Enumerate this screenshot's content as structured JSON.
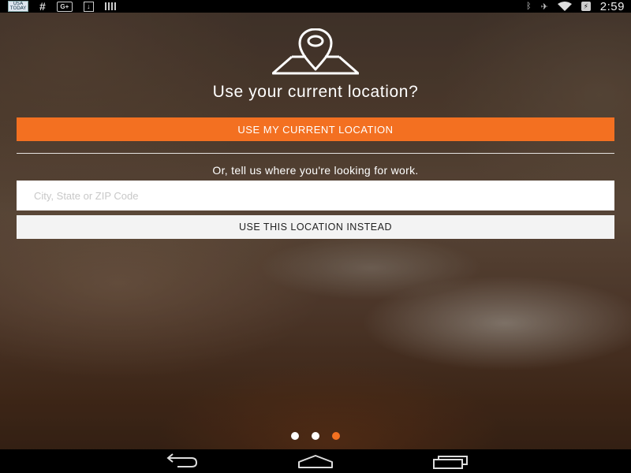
{
  "status_bar": {
    "time": "2:59",
    "news_icon_text": "USA TODAY",
    "icons": [
      "news-app-icon",
      "hashtag-icon",
      "google-plus-icon",
      "download-icon",
      "barcode-icon",
      "bluetooth-icon",
      "airplane-mode-icon",
      "wifi-icon",
      "battery-icon"
    ]
  },
  "prompt": {
    "title": "Use your current location?",
    "use_current_label": "USE MY CURRENT LOCATION",
    "alt_text": "Or, tell us where you're looking for work.",
    "location_placeholder": "City, State or ZIP Code",
    "location_value": "",
    "use_this_label": "USE THIS LOCATION INSTEAD"
  },
  "pager": {
    "total_pages": 3,
    "active_page": 3
  },
  "colors": {
    "accent": "#f37021",
    "status_bar_bg": "#000000",
    "input_bg": "#ffffff",
    "secondary_button_bg": "#f3f3f3"
  },
  "nav_bar": {
    "buttons": [
      "back-icon",
      "home-icon",
      "recents-icon"
    ]
  }
}
